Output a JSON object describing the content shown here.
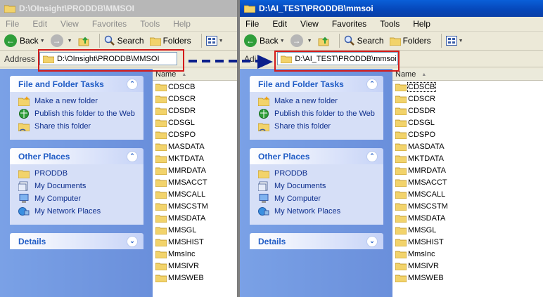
{
  "left": {
    "title": "D:\\OInsight\\PRODDB\\MMSOI",
    "address": "D:\\OInsight\\PRODDB\\MMSOI",
    "files": [
      "CDSCB",
      "CDSCR",
      "CDSDR",
      "CDSGL",
      "CDSPO",
      "MASDATA",
      "MKTDATA",
      "MMRDATA",
      "MMSACCT",
      "MMSCALL",
      "MMSCSTM",
      "MMSDATA",
      "MMSGL",
      "MMSHIST",
      "MmsInc",
      "MMSIVR",
      "MMSWEB"
    ]
  },
  "right": {
    "title": "D:\\AI_TEST\\PRODDB\\mmsoi",
    "address": "D:\\AI_TEST\\PRODDB\\mmsoi",
    "files": [
      "CDSCB",
      "CDSCR",
      "CDSDR",
      "CDSGL",
      "CDSPO",
      "MASDATA",
      "MKTDATA",
      "MMRDATA",
      "MMSACCT",
      "MMSCALL",
      "MMSCSTM",
      "MMSDATA",
      "MMSGL",
      "MMSHIST",
      "MmsInc",
      "MMSIVR",
      "MMSWEB"
    ]
  },
  "menu": [
    "File",
    "Edit",
    "View",
    "Favorites",
    "Tools",
    "Help"
  ],
  "toolbar": {
    "back": "Back",
    "search": "Search",
    "folders": "Folders"
  },
  "address_label": "Address",
  "address_label_right": "Adi",
  "column_name": "Name",
  "panels": {
    "file_tasks": {
      "title": "File and Folder Tasks",
      "items": [
        "Make a new folder",
        "Publish this folder to the Web",
        "Share this folder"
      ]
    },
    "other_places": {
      "title": "Other Places",
      "items": [
        "PRODDB",
        "My Documents",
        "My Computer",
        "My Network Places"
      ]
    },
    "details": {
      "title": "Details"
    }
  },
  "colors": {
    "title_active": "#0a5fd8",
    "annotation_red": "#d41a1a",
    "arrow_blue": "#0b1f8c",
    "task_pane": "#7aa1e6"
  }
}
